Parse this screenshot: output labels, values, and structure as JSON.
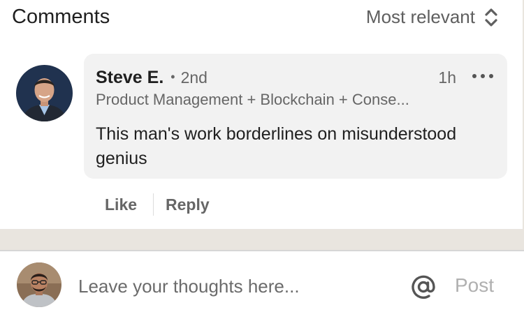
{
  "header": {
    "title": "Comments",
    "sort_label": "Most relevant",
    "sort_icon": "chevron-up-down-icon"
  },
  "comment": {
    "author": "Steve E.",
    "separator": "•",
    "degree": "2nd",
    "time": "1h",
    "headline": "Product Management + Blockchain + Conse...",
    "text": "This man's work borderlines on misunderstood genius",
    "more_icon": "more-dots-icon",
    "actions": {
      "like": "Like",
      "reply": "Reply"
    }
  },
  "composer": {
    "placeholder": "Leave your thoughts here...",
    "value": "",
    "mention_icon": "at-sign-icon",
    "post_label": "Post"
  },
  "colors": {
    "bubble": "#f2f2f2",
    "band": "#e9e5df",
    "text_primary": "#1f1f1f",
    "text_secondary": "#666666",
    "post_disabled": "#b0b0b0"
  }
}
